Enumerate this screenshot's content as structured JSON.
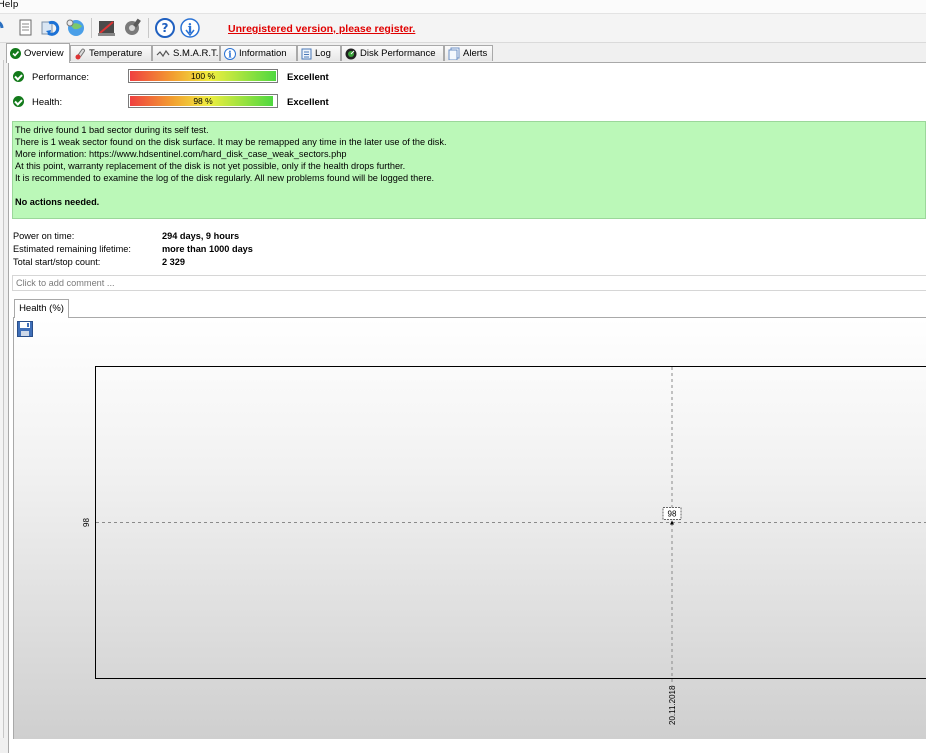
{
  "menu": {
    "help_label": "Help"
  },
  "toolbar": {
    "icons": [
      "report-icon",
      "refresh-icon",
      "network-icon",
      "disk-tools-icon",
      "wrench-icon",
      "help-icon",
      "update-icon"
    ],
    "register_link": "Unregistered version, please register.",
    "register_color": "#e00000"
  },
  "tabs": [
    {
      "label": "Overview",
      "icon": "check-icon",
      "active": true
    },
    {
      "label": "Temperature",
      "icon": "thermometer-icon"
    },
    {
      "label": "S.M.A.R.T.",
      "icon": "smart-icon"
    },
    {
      "label": "Information",
      "icon": "information-icon"
    },
    {
      "label": "Log",
      "icon": "log-icon"
    },
    {
      "label": "Disk Performance",
      "icon": "disk-performance-icon"
    },
    {
      "label": "Alerts",
      "icon": "alerts-icon"
    }
  ],
  "overview": {
    "performance": {
      "label": "Performance:",
      "percent": 100,
      "percent_text": "100 %",
      "rating": "Excellent"
    },
    "health": {
      "label": "Health:",
      "percent": 98,
      "percent_text": "98 %",
      "rating": "Excellent"
    },
    "status_color": "#bbf8b8",
    "message_lines": [
      "The drive found 1 bad sector during its self test.",
      "There is 1 weak sector found on the disk surface. It may be remapped any time in the later use of the disk.",
      "More information: https://www.hdsentinel.com/hard_disk_case_weak_sectors.php",
      "At this point, warranty replacement of the disk is not yet possible, only if the health drops further.",
      "It is recommended to examine the log of the disk regularly. All new problems found will be logged there."
    ],
    "message_conclusion": "No actions needed.",
    "stats": {
      "power_on_label": "Power on time:",
      "power_on_value": "294 days, 9 hours",
      "lifetime_label": "Estimated remaining lifetime:",
      "lifetime_value": "more than 1000 days",
      "startstop_label": "Total start/stop count:",
      "startstop_value": "2 329"
    },
    "comment_placeholder": "Click to add comment ..."
  },
  "health_chart": {
    "tab_label": "Health (%)",
    "save_icon": "save-icon"
  },
  "chart_data": {
    "type": "line",
    "title": "",
    "xlabel": "",
    "ylabel": "",
    "x": [
      "20.11.2018"
    ],
    "series": [
      {
        "values": [
          98
        ]
      }
    ],
    "y_tick_labels": [
      "98"
    ],
    "x_tick_labels": [
      "20.11.2018"
    ],
    "data_labels": [
      "98"
    ],
    "grid": "dashed crosshair at data point"
  }
}
